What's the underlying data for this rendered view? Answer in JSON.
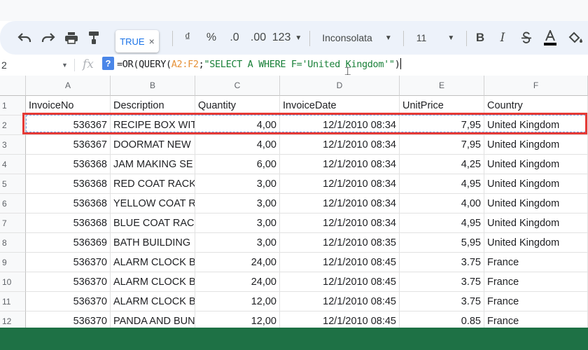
{
  "toolbar": {
    "tooltip_value": "TRUE",
    "tooltip_close": "×",
    "currency": "₫",
    "percent": "%",
    "decrease_decimals": ".0",
    "increase_decimals": ".00",
    "number_format": "123",
    "font_family": "Inconsolata",
    "font_size": "11",
    "bold": "B",
    "italic": "I"
  },
  "formula_bar": {
    "name_box": "2",
    "fx": "fx",
    "help": "?",
    "formula": {
      "prefix": "=OR(QUERY(",
      "range": "A2:F2",
      "sep": ";",
      "query": "\"SELECT A WHERE F='United Kingdom'\"",
      "suffix": ")"
    }
  },
  "sheet": {
    "column_letters": [
      "A",
      "B",
      "C",
      "D",
      "E",
      "F"
    ],
    "row_numbers": [
      "1",
      "2",
      "3",
      "4",
      "5",
      "6",
      "7",
      "8",
      "9",
      "10",
      "11",
      "12"
    ],
    "rows": [
      [
        "InvoiceNo",
        "Description",
        "Quantity",
        "InvoiceDate",
        "UnitPrice",
        "Country"
      ],
      [
        "536367",
        "RECIPE BOX WIT",
        "4,00",
        "12/1/2010 08:34",
        "7,95",
        "United Kingdom"
      ],
      [
        "536367",
        "DOORMAT NEW",
        "4,00",
        "12/1/2010 08:34",
        "7,95",
        "United Kingdom"
      ],
      [
        "536368",
        "JAM MAKING SE",
        "6,00",
        "12/1/2010 08:34",
        "4,25",
        "United Kingdom"
      ],
      [
        "536368",
        "RED COAT RACK",
        "3,00",
        "12/1/2010 08:34",
        "4,95",
        "United Kingdom"
      ],
      [
        "536368",
        "YELLOW COAT R",
        "3,00",
        "12/1/2010 08:34",
        "4,00",
        "United Kingdom"
      ],
      [
        "536368",
        "BLUE COAT RACK",
        "3,00",
        "12/1/2010 08:34",
        "4,95",
        "United Kingdom"
      ],
      [
        "536369",
        "BATH BUILDING",
        "3,00",
        "12/1/2010 08:35",
        "5,95",
        "United Kingdom"
      ],
      [
        "536370",
        "ALARM CLOCK B",
        "24,00",
        "12/1/2010 08:45",
        "3.75",
        "France"
      ],
      [
        "536370",
        "ALARM CLOCK B",
        "24,00",
        "12/1/2010 08:45",
        "3.75",
        "France"
      ],
      [
        "536370",
        "ALARM CLOCK B",
        "12,00",
        "12/1/2010 08:45",
        "3.75",
        "France"
      ],
      [
        "536370",
        "PANDA AND BUN",
        "12,00",
        "12/1/2010 08:45",
        "0.85",
        "France"
      ]
    ]
  },
  "colors": {
    "highlight_border": "#e53935",
    "footer_bar": "#1e7145",
    "toolbar_bg": "#edf2fa",
    "formula_range": "#e69138",
    "formula_string": "#188038"
  }
}
